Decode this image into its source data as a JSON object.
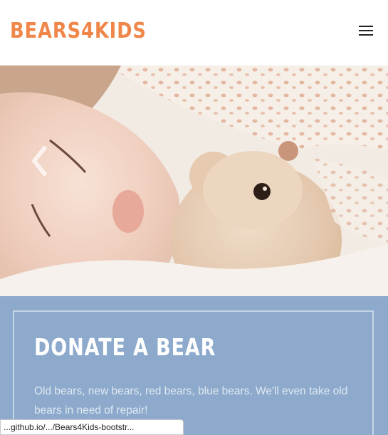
{
  "navbar": {
    "brand": "BEARS4KIDS",
    "menu_icon": "hamburger-menu-icon",
    "brand_color": "#f0874a"
  },
  "carousel": {
    "image_alt": "Child sleeping with a teddy bear",
    "prev_icon": "chevron-left-icon"
  },
  "donate": {
    "title": "DONATE A BEAR",
    "text": "Old bears, new bears, red bears, blue bears. We'll even take old bears in need of repair!",
    "background": "#8daacc"
  },
  "status_bar": {
    "url": "...github.io/.../Bears4Kids-bootstr..."
  }
}
